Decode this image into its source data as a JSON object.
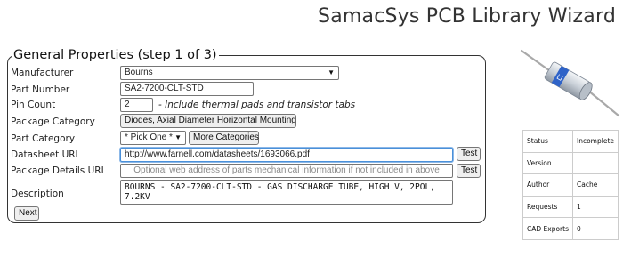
{
  "app": {
    "title": "SamacSys PCB Library Wizard"
  },
  "form": {
    "legend": "General Properties (step 1 of 3)",
    "manufacturer": {
      "label": "Manufacturer",
      "value": "Bourns"
    },
    "part_number": {
      "label": "Part Number",
      "value": "SA2-7200-CLT-STD"
    },
    "pin_count": {
      "label": "Pin Count",
      "value": "2",
      "hint": "- Include thermal pads and transistor tabs"
    },
    "package_category": {
      "label": "Package Category",
      "button_label": "Diodes, Axial Diameter Horizontal Mounting"
    },
    "part_category": {
      "label": "Part Category",
      "value": "* Pick One *",
      "more_label": "More Categories"
    },
    "datasheet_url": {
      "label": "Datasheet URL",
      "value": "http://www.farnell.com/datasheets/1693066.pdf",
      "test_label": "Test"
    },
    "package_details_url": {
      "label": "Package Details URL",
      "placeholder": "Optional web address of parts mechanical information if not included in above",
      "test_label": "Test"
    },
    "description": {
      "label": "Description",
      "value": "BOURNS - SA2-7200-CLT-STD - GAS DISCHARGE TUBE, HIGH V, 2POL, 7.2KV"
    },
    "next_label": "Next"
  },
  "status_table": {
    "rows": [
      {
        "key": "Status",
        "value": "Incomplete"
      },
      {
        "key": "Version",
        "value": ""
      },
      {
        "key": "Author",
        "value": "Cache"
      },
      {
        "key": "Requests",
        "value": "1"
      },
      {
        "key": "CAD Exports",
        "value": "0"
      }
    ]
  },
  "colors": {
    "body_blue": "#2f63c8",
    "body_light": "#dfe4ea",
    "lead": "#a9a9a9"
  },
  "icons": {
    "component": "gas-discharge-tube-image",
    "select_arrow": "chevron-down-icon"
  }
}
